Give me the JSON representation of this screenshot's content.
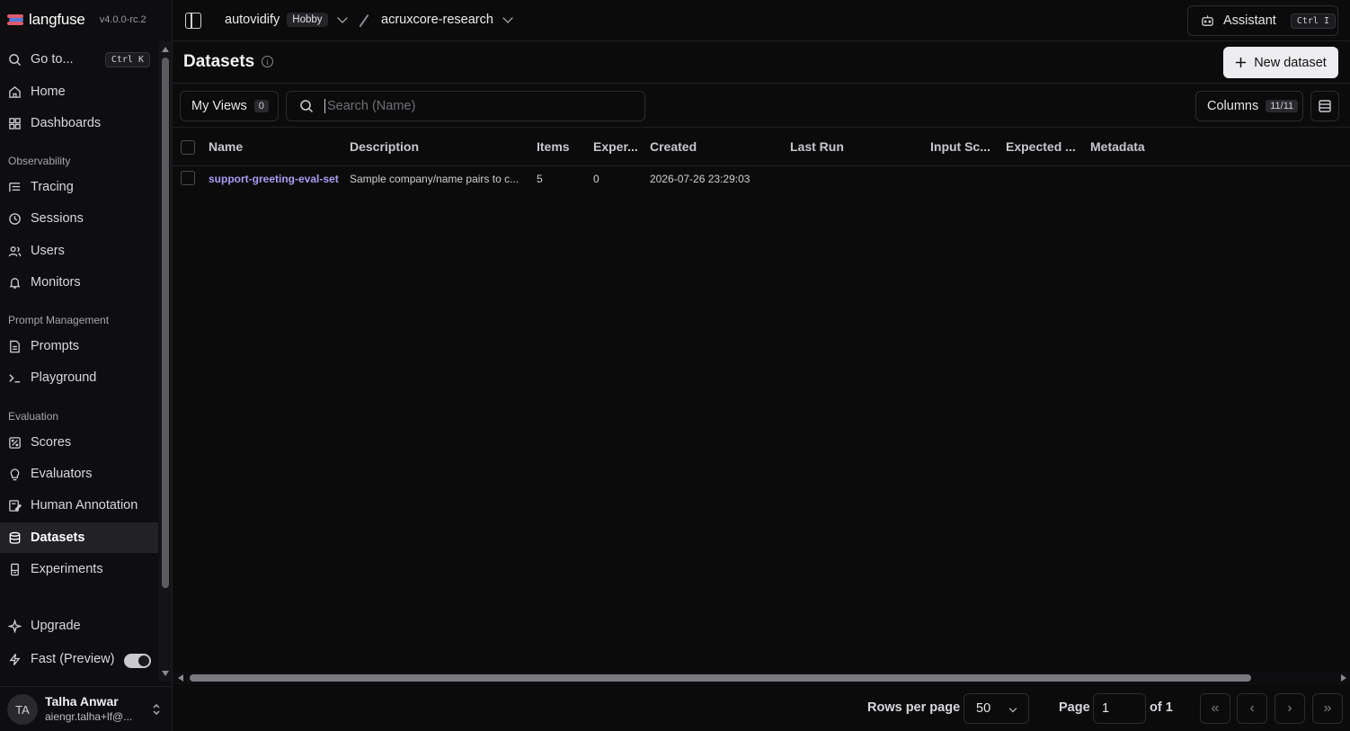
{
  "brand": {
    "name": "langfuse",
    "version": "v4.0.0-rc.2"
  },
  "topbar": {
    "org": "autovidify",
    "plan_badge": "Hobby",
    "project": "acruxcore-research",
    "assistant_label": "Assistant",
    "assistant_kbd": "Ctrl I"
  },
  "sidebar": {
    "goto_label": "Go to...",
    "goto_kbd": "Ctrl K",
    "items": [
      {
        "label": "Home"
      },
      {
        "label": "Dashboards"
      },
      {
        "label": "Tracing"
      },
      {
        "label": "Sessions"
      },
      {
        "label": "Users"
      },
      {
        "label": "Monitors"
      },
      {
        "label": "Prompts"
      },
      {
        "label": "Playground"
      },
      {
        "label": "Scores"
      },
      {
        "label": "Evaluators"
      },
      {
        "label": "Human Annotation"
      },
      {
        "label": "Datasets"
      },
      {
        "label": "Experiments"
      }
    ],
    "sections": [
      "Observability",
      "Prompt Management",
      "Evaluation"
    ],
    "upgrade_label": "Upgrade",
    "fast_label": "Fast (Preview)",
    "fast_enabled": true,
    "active_item": "Datasets"
  },
  "user": {
    "initials": "TA",
    "name": "Talha Anwar",
    "email": "aiengr.talha+lf@..."
  },
  "page": {
    "title": "Datasets",
    "new_button": "New dataset"
  },
  "toolbar": {
    "my_views_label": "My Views",
    "my_views_count": "0",
    "search_placeholder": "Search (Name)",
    "columns_label": "Columns",
    "columns_count": "11/11"
  },
  "table": {
    "headers": [
      "Name",
      "Description",
      "Items",
      "Exper...",
      "Created",
      "Last Run",
      "Input Sc...",
      "Expected ...",
      "Metadata"
    ],
    "rows": [
      {
        "name": "support-greeting-eval-set",
        "description": "Sample company/name pairs to c...",
        "items": "5",
        "experiments": "0",
        "created": "2026-07-26 23:29:03",
        "last_run": "",
        "input_schema": "",
        "expected_schema": "",
        "metadata": ""
      }
    ]
  },
  "footer": {
    "rows_per_page_label": "Rows per page",
    "rows_per_page": "50",
    "page_label": "Page",
    "page_value": "1",
    "of_label": "of 1"
  },
  "colors": {
    "accent_link": "#a99cf3",
    "background": "#0b0b0c",
    "primary_button": "#ededf0"
  }
}
